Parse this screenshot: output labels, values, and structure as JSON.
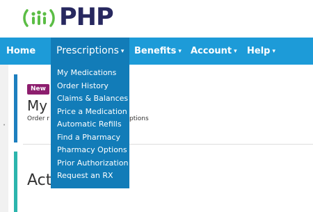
{
  "brand": {
    "name": "PHP",
    "logo_icon": "php-people-logo-icon",
    "colors": {
      "navy": "#27285f",
      "green": "#5bbd45",
      "nav_blue": "#1d9bd8",
      "nav_active": "#127cb8",
      "badge_purple": "#8d1e6e",
      "accent_teal": "#2cb5ad"
    }
  },
  "nav": {
    "items": [
      {
        "label": "Home",
        "has_caret": false
      },
      {
        "label": "Prescriptions",
        "has_caret": true,
        "active": true
      },
      {
        "label": "Benefits",
        "has_caret": true
      },
      {
        "label": "Account",
        "has_caret": true
      },
      {
        "label": "Help",
        "has_caret": true
      }
    ],
    "caret": "▾"
  },
  "dropdown": {
    "items": [
      "My Medications",
      "Order History",
      "Claims & Balances",
      "Price a Medication",
      "Automatic Refills",
      "Find a Pharmacy",
      "Pharmacy Options",
      "Prior Authorization",
      "Request an RX"
    ]
  },
  "card1": {
    "badge": "New",
    "title_visible": "My",
    "subtitle_left": "Order r",
    "subtitle_right": "ptions"
  },
  "card2": {
    "title_visible": "Act"
  }
}
